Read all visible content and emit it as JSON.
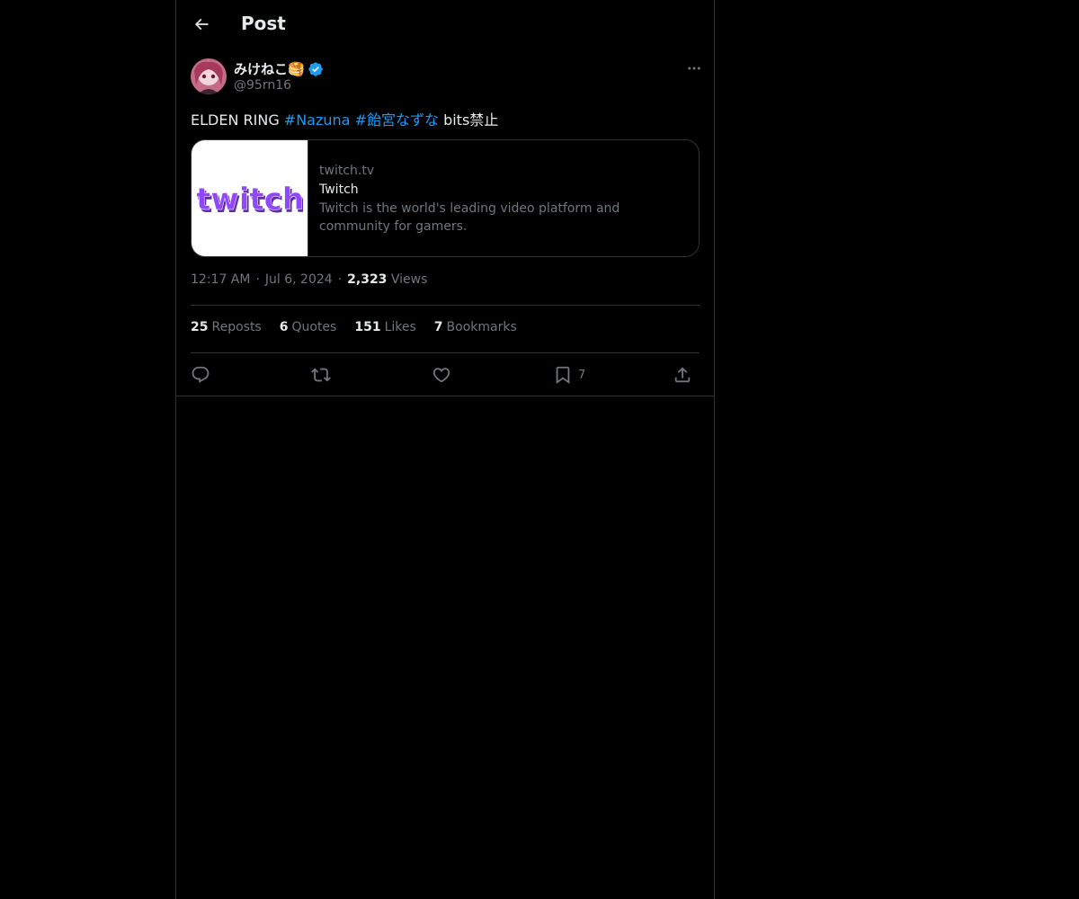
{
  "header": {
    "title": "Post"
  },
  "author": {
    "display_name": "みけねこ🥞",
    "handle": "@95rn16",
    "verified": true
  },
  "tweet": {
    "text_parts": [
      {
        "text": "ELDEN RING ",
        "type": "plain"
      },
      {
        "text": "#Nazuna",
        "type": "hashtag"
      },
      {
        "text": " ",
        "type": "plain"
      },
      {
        "text": "#飴宮なずな",
        "type": "hashtag"
      },
      {
        "text": " bits禁止",
        "type": "plain"
      }
    ]
  },
  "link_card": {
    "domain": "twitch.tv",
    "title": "Twitch",
    "description_line1": "Twitch is the world's leading video platform and",
    "description_line2": "community for gamers.",
    "thumbnail_logo_text": "twitch"
  },
  "meta": {
    "time": "12:17 AM",
    "date": "Jul 6, 2024",
    "views_count": "2,323",
    "views_label": "Views",
    "separator": "·"
  },
  "stats": {
    "reposts": {
      "count": "25",
      "label": "Reposts"
    },
    "quotes": {
      "count": "6",
      "label": "Quotes"
    },
    "likes": {
      "count": "151",
      "label": "Likes"
    },
    "bookmarks": {
      "count": "7",
      "label": "Bookmarks"
    }
  },
  "actions": {
    "reply_icon": "reply-icon",
    "repost_icon": "repost-icon",
    "like_icon": "heart-icon",
    "bookmark_icon": "bookmark-icon",
    "bookmark_count": "7",
    "share_icon": "share-icon"
  },
  "colors": {
    "background": "#000000",
    "text_primary": "#e7e9ea",
    "text_secondary": "#71767b",
    "accent": "#1d9bf0",
    "border": "#2f3336",
    "twitch_purple": "#9146ff"
  }
}
